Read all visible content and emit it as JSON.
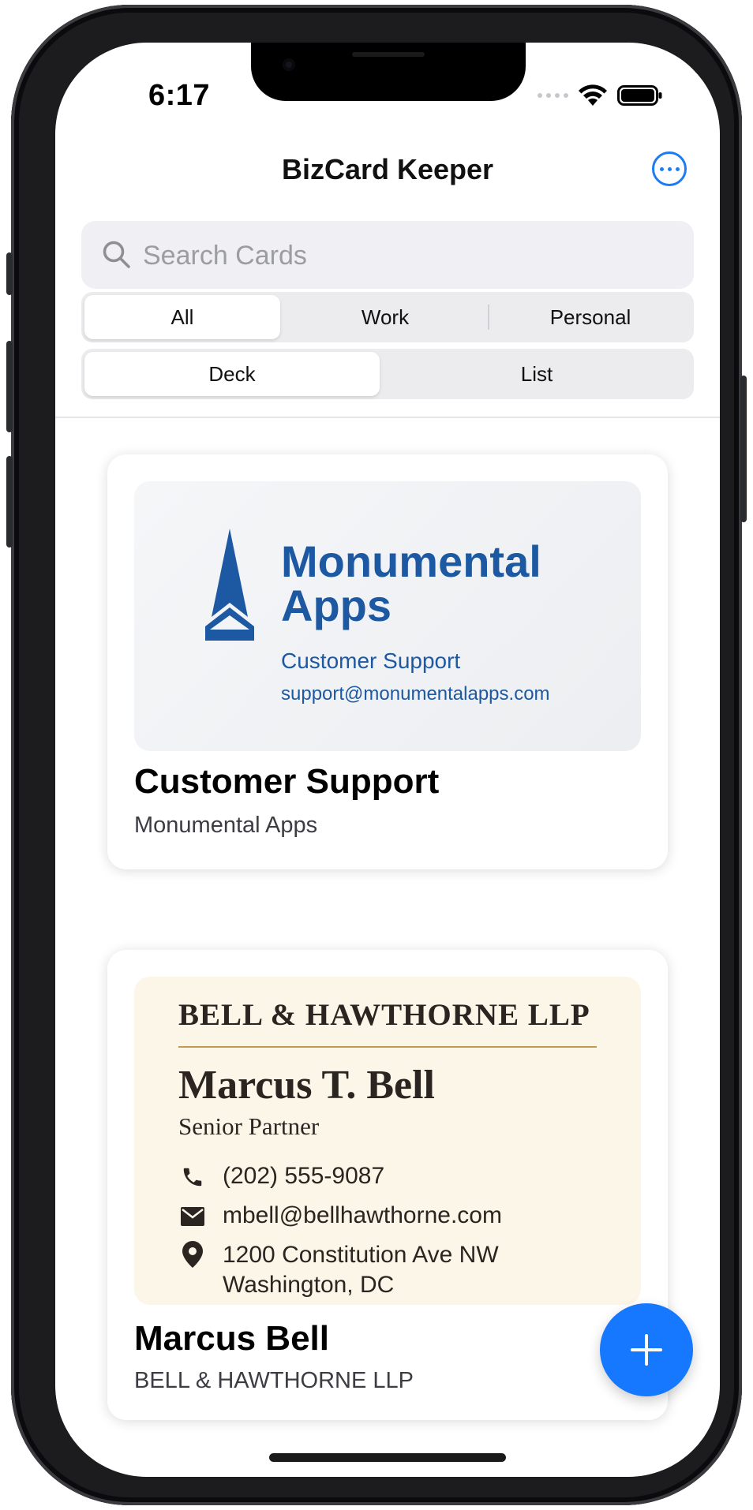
{
  "status_bar": {
    "time": "6:17"
  },
  "header": {
    "title": "BizCard Keeper"
  },
  "search": {
    "placeholder": "Search Cards",
    "value": ""
  },
  "filter_tabs": [
    {
      "label": "All",
      "selected": true
    },
    {
      "label": "Work",
      "selected": false
    },
    {
      "label": "Personal",
      "selected": false
    }
  ],
  "view_tabs": [
    {
      "label": "Deck",
      "selected": true
    },
    {
      "label": "List",
      "selected": false
    }
  ],
  "cards": [
    {
      "title": "Customer Support",
      "subtitle": "Monumental Apps",
      "image": {
        "brand_line1": "Monumental",
        "brand_line2": "Apps",
        "role": "Customer Support",
        "email": "support@monumentalapps.com",
        "brand_color": "#1d59a3"
      }
    },
    {
      "title": "Marcus Bell",
      "subtitle": "BELL & HAWTHORNE LLP",
      "image": {
        "firm": "BELL & HAWTHORNE LLP",
        "name": "Marcus T. Bell",
        "position": "Senior Partner",
        "phone": "(202) 555-9087",
        "email": "mbell@bellhawthorne.com",
        "address_line1": "1200 Constitution Ave NW",
        "address_line2": "Washington, DC",
        "accent_color": "#c69a52"
      }
    }
  ],
  "fab": {
    "icon": "plus-icon"
  },
  "colors": {
    "accent": "#1677ff",
    "link": "#1e7cf2"
  }
}
